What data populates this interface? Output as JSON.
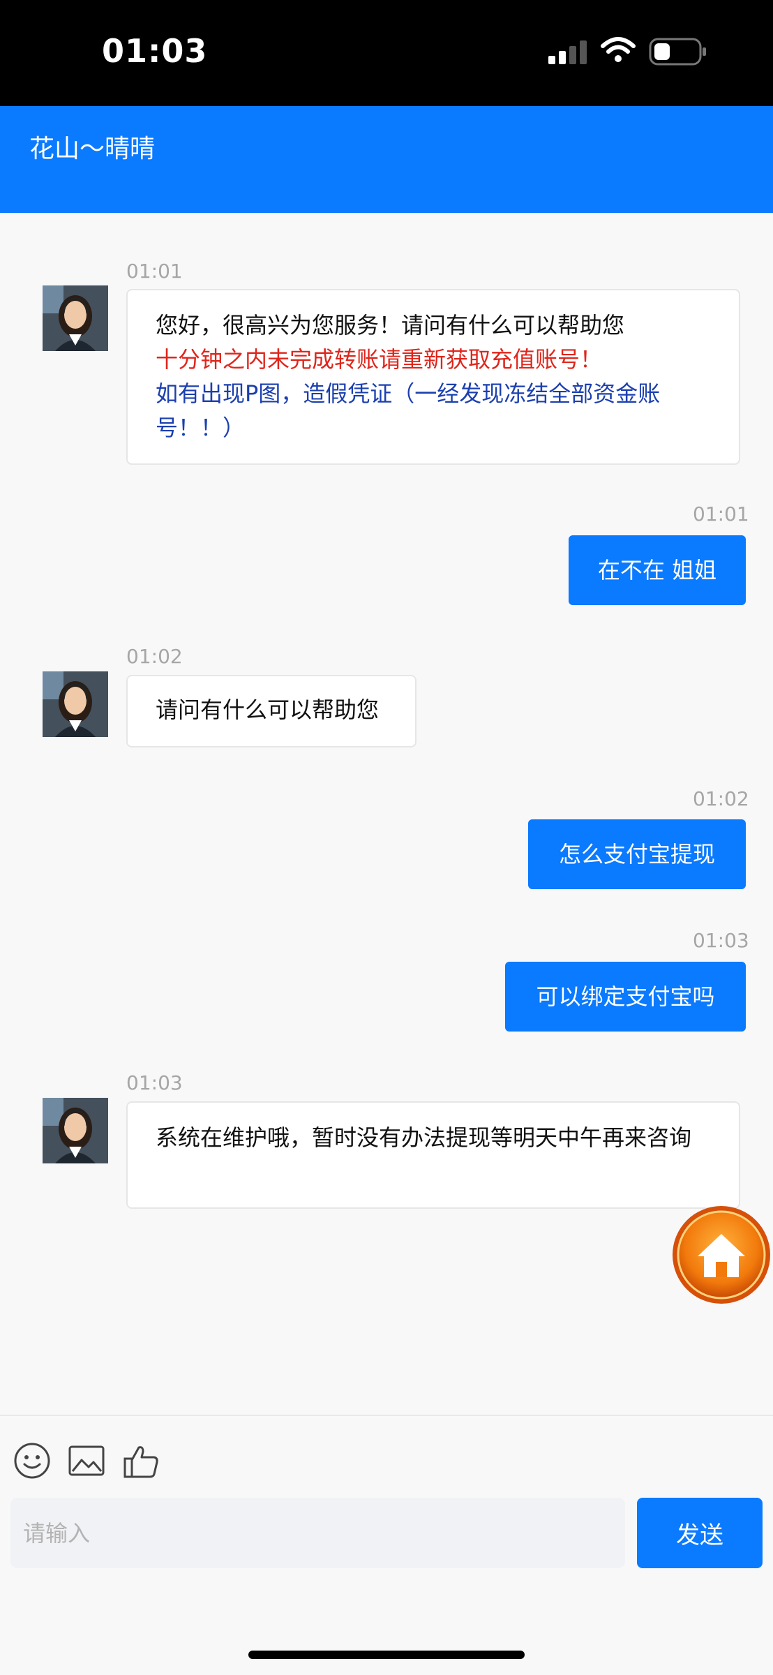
{
  "status_bar": {
    "time": "01:03"
  },
  "header": {
    "title": "花山～晴晴"
  },
  "messages": [
    {
      "side": "in",
      "time": "01:01",
      "lines": [
        {
          "text": "您好，很高兴为您服务！请问有什么可以帮助您",
          "color": "#111111"
        },
        {
          "text": "十分钟之内未完成转账请重新获取充值账号！",
          "color": "#e0251b"
        },
        {
          "text": "如有出现P图，造假凭证（一经发现冻结全部资金账号！！）",
          "color": "#1b3fb0"
        }
      ]
    },
    {
      "side": "out",
      "time": "01:01",
      "text": "在不在 姐姐"
    },
    {
      "side": "in",
      "time": "01:02",
      "text": "请问有什么可以帮助您"
    },
    {
      "side": "out",
      "time": "01:02",
      "text": "怎么支付宝提现"
    },
    {
      "side": "out",
      "time": "01:03",
      "text": "可以绑定支付宝吗"
    },
    {
      "side": "in",
      "time": "01:03",
      "text": "系统在维护哦，暂时没有办法提现等明天中午再来咨询"
    }
  ],
  "composer": {
    "placeholder": "请输入",
    "send_label": "发送",
    "tools": [
      "emoji-icon",
      "image-icon",
      "thumbs-up-icon"
    ]
  },
  "colors": {
    "accent": "#0a7aff",
    "warning_red": "#e0251b",
    "notice_blue": "#1b3fb0"
  }
}
